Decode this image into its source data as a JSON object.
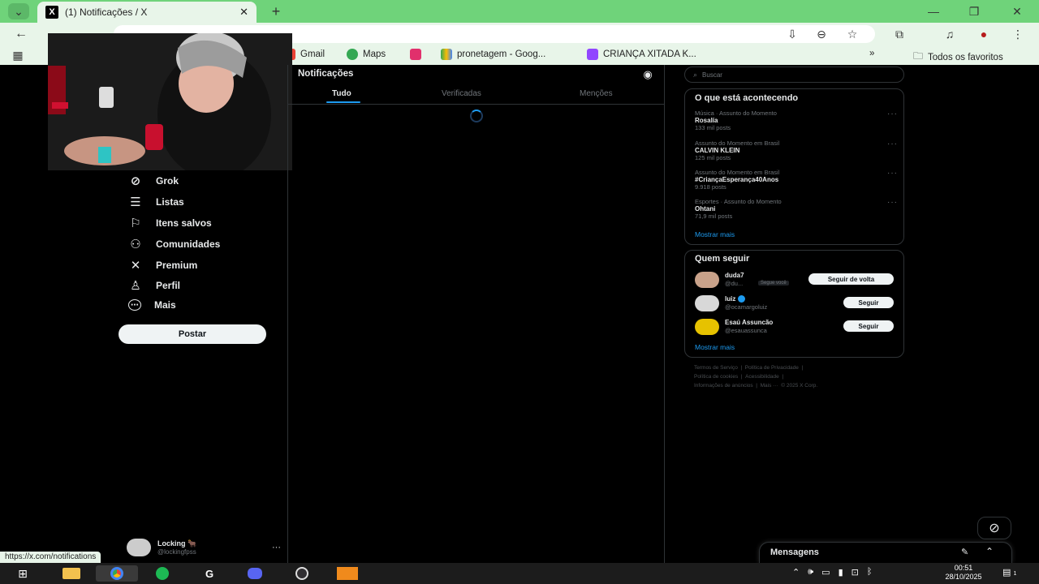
{
  "browser": {
    "tab_title": "(1) Notificações / X",
    "bookmarks": [
      {
        "label": "Gmail",
        "color": "#ea4335"
      },
      {
        "label": "Maps",
        "color": "#34a853"
      },
      {
        "label": "",
        "color": "#e1306c"
      },
      {
        "label": "pronetagem - Goog...",
        "color": "#fbbc04"
      },
      {
        "label": "CRIANÇA XITADA K...",
        "color": "#9146ff"
      }
    ],
    "all_bookmarks_label": "Todos os favoritos",
    "more_bookmarks": "»",
    "status_url": "https://x.com/notifications"
  },
  "nav": {
    "items": [
      {
        "label": "Grok",
        "icon": "grok-icon",
        "glyph": "⊘"
      },
      {
        "label": "Listas",
        "icon": "list-icon",
        "glyph": "☰"
      },
      {
        "label": "Itens salvos",
        "icon": "bookmark-icon",
        "glyph": "⚐"
      },
      {
        "label": "Comunidades",
        "icon": "communities-icon",
        "glyph": "⚇"
      },
      {
        "label": "Premium",
        "icon": "x-logo-icon",
        "glyph": "✕"
      },
      {
        "label": "Perfil",
        "icon": "profile-icon",
        "glyph": "♙"
      },
      {
        "label": "Mais",
        "icon": "more-circle-icon",
        "glyph": "⋯"
      }
    ],
    "post_button": "Postar",
    "account": {
      "name": "Locking 🐂",
      "handle": "@lockingfpss",
      "more": "···"
    }
  },
  "main": {
    "title": "Notificações",
    "tabs": [
      "Tudo",
      "Verificadas",
      "Menções"
    ],
    "active_tab": "Tudo"
  },
  "sidebar": {
    "search_placeholder": "Buscar",
    "trends_title": "O que está acontecendo",
    "trends": [
      {
        "context": "Música · Assunto do Momento",
        "name": "Rosalía",
        "count": "133 mil posts"
      },
      {
        "context": "Assunto do Momento em Brasil",
        "name": "CALVIN KLEIN",
        "count": "125 mil posts"
      },
      {
        "context": "Assunto do Momento em Brasil",
        "name": "#CriançaEsperança40Anos",
        "count": "9.918 posts"
      },
      {
        "context": "Esportes · Assunto do Momento",
        "name": "Ohtani",
        "count": "71,9 mil posts"
      }
    ],
    "trends_more": "Mostrar mais",
    "follow_title": "Quem seguir",
    "follow": [
      {
        "name": "duda7",
        "handle": "@du...",
        "badge": "Segue você",
        "button": "Seguir de volta",
        "avatar_color": "#c9a28a"
      },
      {
        "name": "luiz",
        "handle": "@ocamargoluiz",
        "badge": "",
        "button": "Seguir",
        "avatar_color": "#d8d8d8"
      },
      {
        "name": "Esaú Assuncão",
        "handle": "@esauassunca",
        "badge": "",
        "button": "Seguir",
        "avatar_color": "#e6c200"
      }
    ],
    "follow_more": "Mostrar mais",
    "footer": [
      "Termos de Serviço",
      "|",
      "Política de Privacidade",
      "|",
      "Política de cookies",
      "|",
      "Acessibilidade",
      "|",
      "Informações de anúncios",
      "|",
      "Mais ···",
      "© 2025 X Corp."
    ],
    "messages_label": "Mensagens"
  },
  "taskbar": {
    "time": "00:51",
    "date": "28/10/2025",
    "notification_count": "1"
  }
}
